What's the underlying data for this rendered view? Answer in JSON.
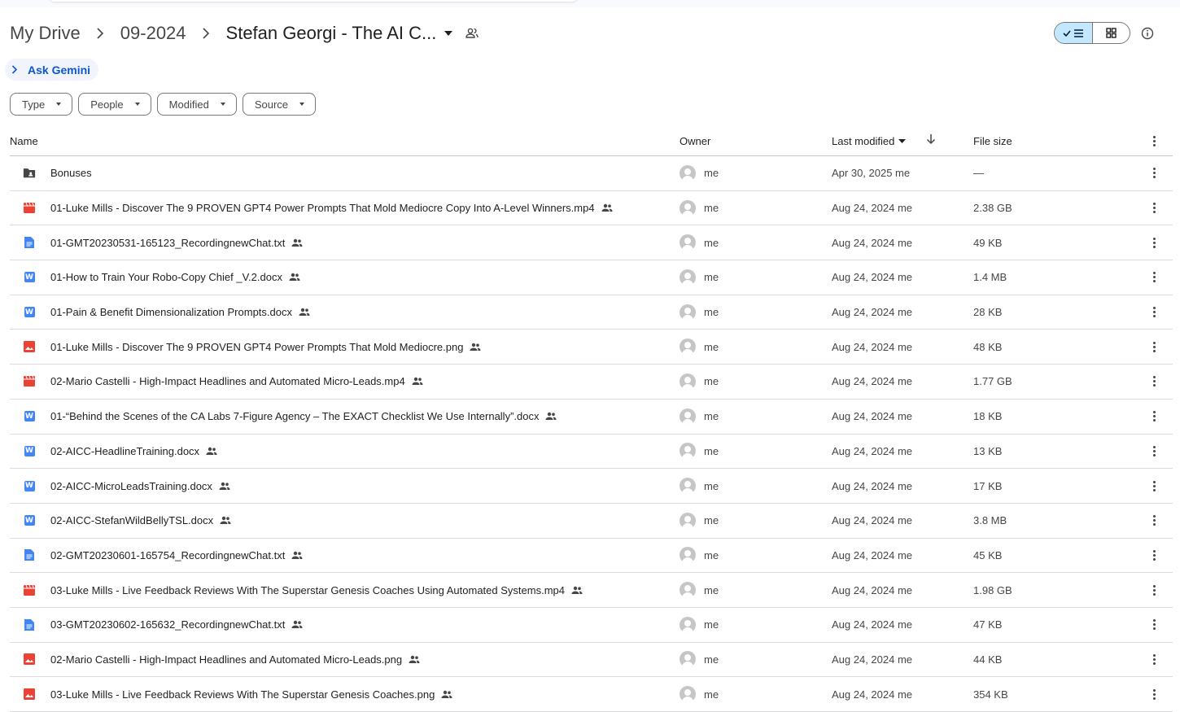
{
  "breadcrumb": {
    "items": [
      "My Drive",
      "09-2024",
      "Stefan Georgi - The AI C..."
    ]
  },
  "gemini": {
    "label": "Ask Gemini"
  },
  "filters": [
    "Type",
    "People",
    "Modified",
    "Source"
  ],
  "columns": {
    "name": "Name",
    "owner": "Owner",
    "modified": "Last modified",
    "size": "File size"
  },
  "colors": {
    "accent": "#0b57d0",
    "video": "#ea4335",
    "image": "#ea4335",
    "doc": "#4285f4",
    "text": "#4285f4",
    "folder": "#444746"
  },
  "rows": [
    {
      "icon": "folder",
      "name": "Bonuses",
      "shared": false,
      "owner": "me",
      "modified": "Apr 30, 2025 me",
      "size": "—"
    },
    {
      "icon": "video",
      "name": "01-Luke Mills - Discover The 9 PROVEN GPT4 Power Prompts That Mold Mediocre Copy Into A-Level Winners.mp4",
      "shared": true,
      "owner": "me",
      "modified": "Aug 24, 2024 me",
      "size": "2.38 GB"
    },
    {
      "icon": "text",
      "name": "01-GMT20230531-165123_RecordingnewChat.txt",
      "shared": true,
      "owner": "me",
      "modified": "Aug 24, 2024 me",
      "size": "49 KB"
    },
    {
      "icon": "word",
      "name": "01-How to Train Your Robo-Copy Chief _V.2.docx",
      "shared": true,
      "owner": "me",
      "modified": "Aug 24, 2024 me",
      "size": "1.4 MB"
    },
    {
      "icon": "word",
      "name": "01-Pain & Benefit Dimensionalization Prompts.docx",
      "shared": true,
      "owner": "me",
      "modified": "Aug 24, 2024 me",
      "size": "28 KB"
    },
    {
      "icon": "image",
      "name": "01-Luke Mills - Discover The 9 PROVEN GPT4 Power Prompts That Mold Mediocre.png",
      "shared": true,
      "owner": "me",
      "modified": "Aug 24, 2024 me",
      "size": "48 KB"
    },
    {
      "icon": "video",
      "name": "02-Mario Castelli - High-Impact Headlines and Automated Micro-Leads.mp4",
      "shared": true,
      "owner": "me",
      "modified": "Aug 24, 2024 me",
      "size": "1.77 GB"
    },
    {
      "icon": "word",
      "name": "01-“Behind the Scenes of the CA Labs 7-Figure Agency – The EXACT Checklist We Use Internally”.docx",
      "shared": true,
      "owner": "me",
      "modified": "Aug 24, 2024 me",
      "size": "18 KB"
    },
    {
      "icon": "word",
      "name": "02-AICC-HeadlineTraining.docx",
      "shared": true,
      "owner": "me",
      "modified": "Aug 24, 2024 me",
      "size": "13 KB"
    },
    {
      "icon": "word",
      "name": "02-AICC-MicroLeadsTraining.docx",
      "shared": true,
      "owner": "me",
      "modified": "Aug 24, 2024 me",
      "size": "17 KB"
    },
    {
      "icon": "word",
      "name": "02-AICC-StefanWildBellyTSL.docx",
      "shared": true,
      "owner": "me",
      "modified": "Aug 24, 2024 me",
      "size": "3.8 MB"
    },
    {
      "icon": "text",
      "name": "02-GMT20230601-165754_RecordingnewChat.txt",
      "shared": true,
      "owner": "me",
      "modified": "Aug 24, 2024 me",
      "size": "45 KB"
    },
    {
      "icon": "video",
      "name": "03-Luke Mills - Live Feedback Reviews With The Superstar Genesis Coaches  Using Automated Systems.mp4",
      "shared": true,
      "owner": "me",
      "modified": "Aug 24, 2024 me",
      "size": "1.98 GB"
    },
    {
      "icon": "text",
      "name": "03-GMT20230602-165632_RecordingnewChat.txt",
      "shared": true,
      "owner": "me",
      "modified": "Aug 24, 2024 me",
      "size": "47 KB"
    },
    {
      "icon": "image",
      "name": "02-Mario Castelli - High-Impact Headlines and Automated Micro-Leads.png",
      "shared": true,
      "owner": "me",
      "modified": "Aug 24, 2024 me",
      "size": "44 KB"
    },
    {
      "icon": "image",
      "name": "03-Luke Mills - Live Feedback Reviews With The Superstar Genesis Coaches.png",
      "shared": true,
      "owner": "me",
      "modified": "Aug 24, 2024 me",
      "size": "354 KB"
    }
  ]
}
